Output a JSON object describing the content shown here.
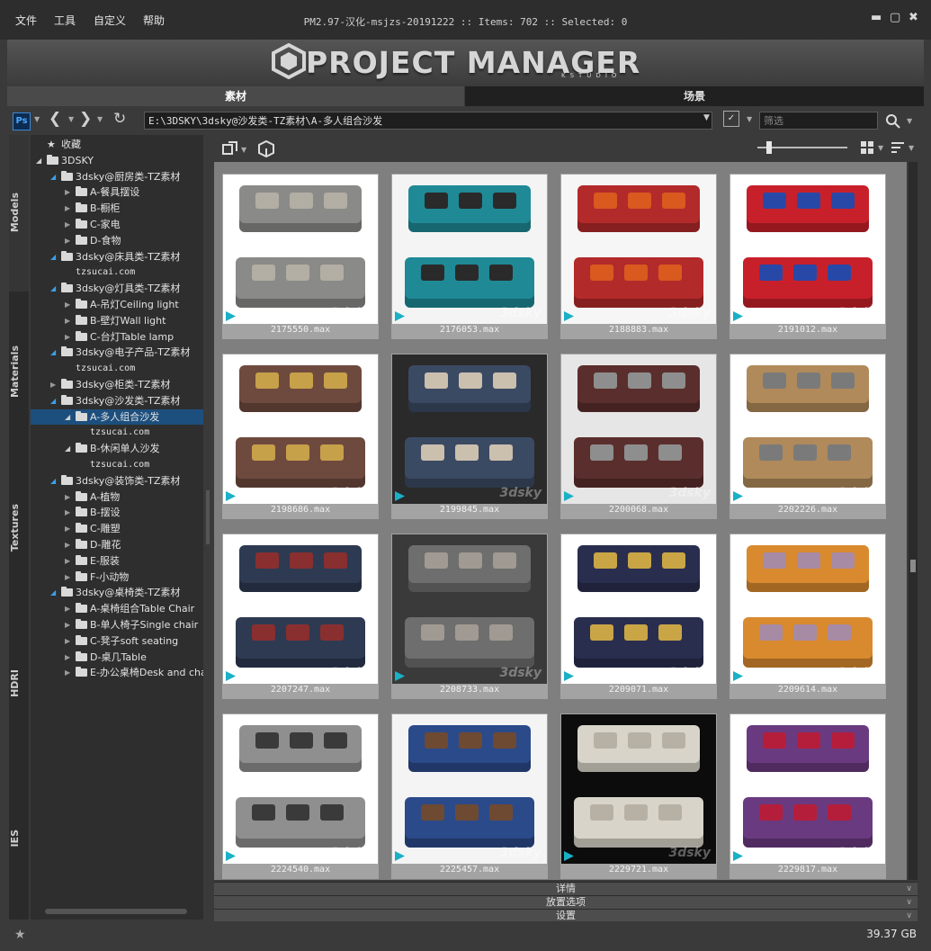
{
  "menu": [
    "文件",
    "工具",
    "自定义",
    "帮助"
  ],
  "app_title": "PM2.97-汉化-msjzs-20191222  :: Items: 702  :: Selected: 0",
  "window_controls": {
    "close_icon": "close-icon",
    "maximize_icon": "maximize-icon",
    "minimize_icon": "minimize-icon"
  },
  "logo": {
    "title": "PROJECT MANAGER",
    "subtitle": "KSTUDIO"
  },
  "tabs": [
    {
      "label": "素材",
      "active": true
    },
    {
      "label": "场景",
      "active": false
    }
  ],
  "toolbar": {
    "path": "E:\\3DSKY\\3dsky@沙发类-TZ素材\\A-多人组合沙发",
    "filter_placeholder": "筛选",
    "ps_label": "Ps"
  },
  "side_tabs": [
    "Models",
    "Materials",
    "Textures",
    "HDRI",
    "IES"
  ],
  "tree": [
    {
      "label": "收藏",
      "level": 0,
      "type": "fav"
    },
    {
      "label": "3DSKY",
      "level": 0,
      "type": "root",
      "expanded": true
    },
    {
      "label": "3dsky@厨房类-TZ素材",
      "level": 1,
      "expanded": true
    },
    {
      "label": "A-餐具摆设",
      "level": 2
    },
    {
      "label": "B-橱柜",
      "level": 2
    },
    {
      "label": "C-家电",
      "level": 2
    },
    {
      "label": "D-食物",
      "level": 2
    },
    {
      "label": "3dsky@床具类-TZ素材",
      "level": 1,
      "expanded": true
    },
    {
      "label": "tzsucai.com",
      "level": 2,
      "leaf": true
    },
    {
      "label": "3dsky@灯具类-TZ素材",
      "level": 1,
      "expanded": true
    },
    {
      "label": "A-吊灯Ceiling light",
      "level": 2
    },
    {
      "label": "B-壁灯Wall light",
      "level": 2
    },
    {
      "label": "C-台灯Table lamp",
      "level": 2
    },
    {
      "label": "3dsky@电子产品-TZ素材",
      "level": 1,
      "expanded": true
    },
    {
      "label": "tzsucai.com",
      "level": 2,
      "leaf": true
    },
    {
      "label": "3dsky@柜类-TZ素材",
      "level": 1
    },
    {
      "label": "3dsky@沙发类-TZ素材",
      "level": 1,
      "expanded": true
    },
    {
      "label": "A-多人组合沙发",
      "level": 2,
      "selected": true,
      "expanded": true
    },
    {
      "label": "tzsucai.com",
      "level": 3,
      "leaf": true
    },
    {
      "label": "B-休闲单人沙发",
      "level": 2,
      "expanded": true
    },
    {
      "label": "tzsucai.com",
      "level": 3,
      "leaf": true
    },
    {
      "label": "3dsky@装饰类-TZ素材",
      "level": 1,
      "expanded": true
    },
    {
      "label": "A-植物",
      "level": 2
    },
    {
      "label": "B-摆设",
      "level": 2
    },
    {
      "label": "C-雕塑",
      "level": 2
    },
    {
      "label": "D-雕花",
      "level": 2
    },
    {
      "label": "E-服装",
      "level": 2
    },
    {
      "label": "F-小动物",
      "level": 2
    },
    {
      "label": "3dsky@桌椅类-TZ素材",
      "level": 1,
      "expanded": true
    },
    {
      "label": "A-桌椅组合Table Chair",
      "level": 2
    },
    {
      "label": "B-单人椅子Single chair",
      "level": 2
    },
    {
      "label": "C-凳子soft seating",
      "level": 2
    },
    {
      "label": "D-桌几Table",
      "level": 2
    },
    {
      "label": "E-办公桌椅Desk and chair",
      "level": 2
    }
  ],
  "items": [
    {
      "name": "2175550.max",
      "bg": "#ffffff",
      "sofa": "#8a8a88",
      "cush": "#b3aea4",
      "dark": false
    },
    {
      "name": "2176053.max",
      "bg": "#f4f4f4",
      "sofa": "#1f8a96",
      "cush": "#2a2a2a",
      "dark": false
    },
    {
      "name": "2188883.max",
      "bg": "#f6f6f6",
      "sofa": "#b32a2a",
      "cush": "#d9591f",
      "dark": false
    },
    {
      "name": "2191012.max",
      "bg": "#ffffff",
      "sofa": "#c8202a",
      "cush": "#2848a8",
      "dark": false
    },
    {
      "name": "2198686.max",
      "bg": "#ffffff",
      "sofa": "#6e4a3e",
      "cush": "#c7a04a",
      "dark": false
    },
    {
      "name": "2199845.max",
      "bg": "#2a2a2a",
      "sofa": "#3b4a63",
      "cush": "#cbbfae",
      "dark": true
    },
    {
      "name": "2200068.max",
      "bg": "#e6e6e6",
      "sofa": "#5a2e2c",
      "cush": "#8e8e8e",
      "dark": false
    },
    {
      "name": "2202226.max",
      "bg": "#ffffff",
      "sofa": "#b08a5a",
      "cush": "#7a7a7a",
      "dark": false
    },
    {
      "name": "2207247.max",
      "bg": "#ffffff",
      "sofa": "#2e3a52",
      "cush": "#8a2f2f",
      "dark": false
    },
    {
      "name": "2208733.max",
      "bg": "#3a3a3a",
      "sofa": "#6e6e6e",
      "cush": "#a09a92",
      "dark": true
    },
    {
      "name": "2209071.max",
      "bg": "#ffffff",
      "sofa": "#2a2e4e",
      "cush": "#c9a546",
      "dark": false
    },
    {
      "name": "2209614.max",
      "bg": "#ffffff",
      "sofa": "#d98a2e",
      "cush": "#a78aa4",
      "dark": false
    },
    {
      "name": "2224540.max",
      "bg": "#ffffff",
      "sofa": "#8f8f8f",
      "cush": "#3a3a3a",
      "dark": false
    },
    {
      "name": "2225457.max",
      "bg": "#f4f4f4",
      "sofa": "#2b4a8a",
      "cush": "#6e4a32",
      "dark": false
    },
    {
      "name": "2229721.max",
      "bg": "#0c0c0c",
      "sofa": "#d8d4ca",
      "cush": "#b7b1a5",
      "dark": true
    },
    {
      "name": "2229817.max",
      "bg": "#ffffff",
      "sofa": "#6a3a80",
      "cush": "#b51e3a",
      "dark": false
    }
  ],
  "bottom_panels": [
    "详情",
    "放置选项",
    "设置"
  ],
  "status": {
    "disk_free": "39.37 GB"
  },
  "watermark": "3dsky"
}
